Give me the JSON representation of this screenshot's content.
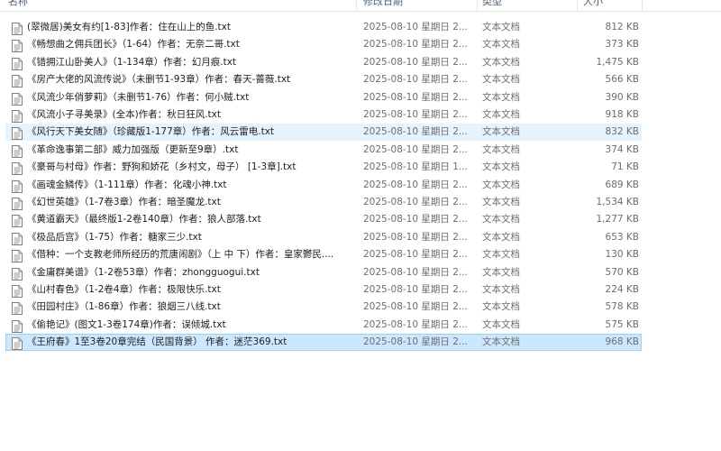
{
  "columns": {
    "name": "名称",
    "date": "修改日期",
    "type": "类型",
    "size": "大小"
  },
  "icon": "text-document-icon",
  "colors": {
    "hover": "#e5f3ff",
    "selected": "#cce8ff",
    "selected_border": "#99d1ff",
    "header_text": "#4c607a"
  },
  "files": [
    {
      "name": "(翠微居)美女有约[1-83]作者：住在山上的鱼.txt",
      "date": "2025-08-10 星期日 2...",
      "type": "文本文档",
      "size": "812 KB"
    },
    {
      "name": "《畅想曲之佣兵团长》（1-64）作者：无奈二哥.txt",
      "date": "2025-08-10 星期日 2...",
      "type": "文本文档",
      "size": "373 KB"
    },
    {
      "name": "《错拥江山卧美人》（1-134章）作者：幻月痕.txt",
      "date": "2025-08-10 星期日 2...",
      "type": "文本文档",
      "size": "1,475 KB"
    },
    {
      "name": "《房产大佬的风流传说》（未删节1-93章）作者：春天-蔷薇.txt",
      "date": "2025-08-10 星期日 2...",
      "type": "文本文档",
      "size": "566 KB"
    },
    {
      "name": "《风流少年俏萝莉》（未删节1-76）作者：何小贼.txt",
      "date": "2025-08-10 星期日 2...",
      "type": "文本文档",
      "size": "390 KB"
    },
    {
      "name": "《风流小子寻美录》(全本)作者：秋日狂风.txt",
      "date": "2025-08-10 星期日 2...",
      "type": "文本文档",
      "size": "918 KB"
    },
    {
      "name": "《风行天下美女随》（珍藏版1-177章）作者：风云雷电.txt",
      "date": "2025-08-10 星期日 2...",
      "type": "文本文档",
      "size": "832 KB"
    },
    {
      "name": "《革命逸事第二部》威力加强版（更新至9章）.txt",
      "date": "2025-08-10 星期日 2...",
      "type": "文本文档",
      "size": "374 KB"
    },
    {
      "name": "《豪哥与村母》作者：野狗和娇花（乡村文，母子）  [1-3章].txt",
      "date": "2025-08-10 星期日 1...",
      "type": "文本文档",
      "size": "71 KB"
    },
    {
      "name": "《画魂金鳞传》（1-111章）作者：化魂小神.txt",
      "date": "2025-08-10 星期日 2...",
      "type": "文本文档",
      "size": "689 KB"
    },
    {
      "name": "《幻世英雄》（1-7卷3章）作者：暗圣魔龙.txt",
      "date": "2025-08-10 星期日 2...",
      "type": "文本文档",
      "size": "1,534 KB"
    },
    {
      "name": "《黄道霸天》（最终版1-2卷140章）作者：狼人部落.txt",
      "date": "2025-08-10 星期日 2...",
      "type": "文本文档",
      "size": "1,277 KB"
    },
    {
      "name": "《极品后宫》（1-75）作者：糖家三少.txt",
      "date": "2025-08-10 星期日 2...",
      "type": "文本文档",
      "size": "653 KB"
    },
    {
      "name": "《借种：一个支教老师所经历的荒唐闹剧》（上 中 下）作者：皇家鬱民....",
      "date": "2025-08-10 星期日 2...",
      "type": "文本文档",
      "size": "130 KB"
    },
    {
      "name": "《金庸群美谱》（1-2卷53章）作者：zhongguogui.txt",
      "date": "2025-08-10 星期日 2...",
      "type": "文本文档",
      "size": "570 KB"
    },
    {
      "name": "《山村春色》（1-2卷4章）作者：极限快乐.txt",
      "date": "2025-08-10 星期日 2...",
      "type": "文本文档",
      "size": "224 KB"
    },
    {
      "name": "《田园村庄》（1-86章）作者：狼烟三八线.txt",
      "date": "2025-08-10 星期日 2...",
      "type": "文本文档",
      "size": "578 KB"
    },
    {
      "name": "《偷艳记》(图文1-3卷174章)作者：误倾城.txt",
      "date": "2025-08-10 星期日 2...",
      "type": "文本文档",
      "size": "575 KB"
    },
    {
      "name": "《王府春》1至3卷20章完结（民国背景） 作者：迷茫369.txt",
      "date": "2025-08-10 星期日 2...",
      "type": "文本文档",
      "size": "968 KB"
    }
  ],
  "hover_index": 6,
  "selected_index": 18
}
